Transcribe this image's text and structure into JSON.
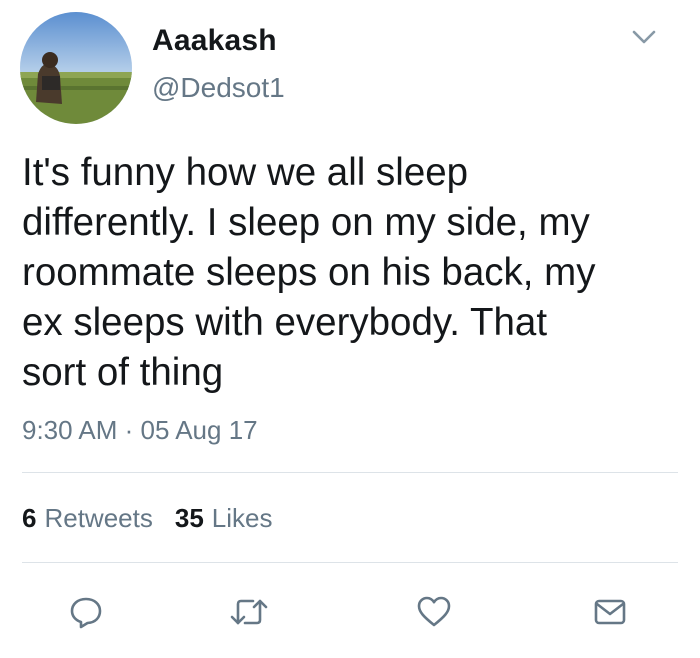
{
  "user": {
    "display_name": "Aaakash",
    "handle": "@Dedsot1"
  },
  "tweet": {
    "text": "It's funny how we all sleep\ndifferently. I sleep on my side, my\nroommate sleeps on his back, my\nex sleeps with everybody. That\nsort of thing",
    "timestamp": "9:30 AM · 05 Aug 17"
  },
  "stats": {
    "retweets_count": "6",
    "retweets_label": "Retweets",
    "likes_count": "35",
    "likes_label": "Likes"
  },
  "icons": {
    "menu": "chevron-down-icon",
    "reply": "reply-icon",
    "retweet": "retweet-icon",
    "like": "heart-icon",
    "message": "envelope-icon"
  },
  "colors": {
    "text_primary": "#14171a",
    "text_secondary": "#657786",
    "icon": "#657786",
    "divider": "#dde3e8"
  }
}
